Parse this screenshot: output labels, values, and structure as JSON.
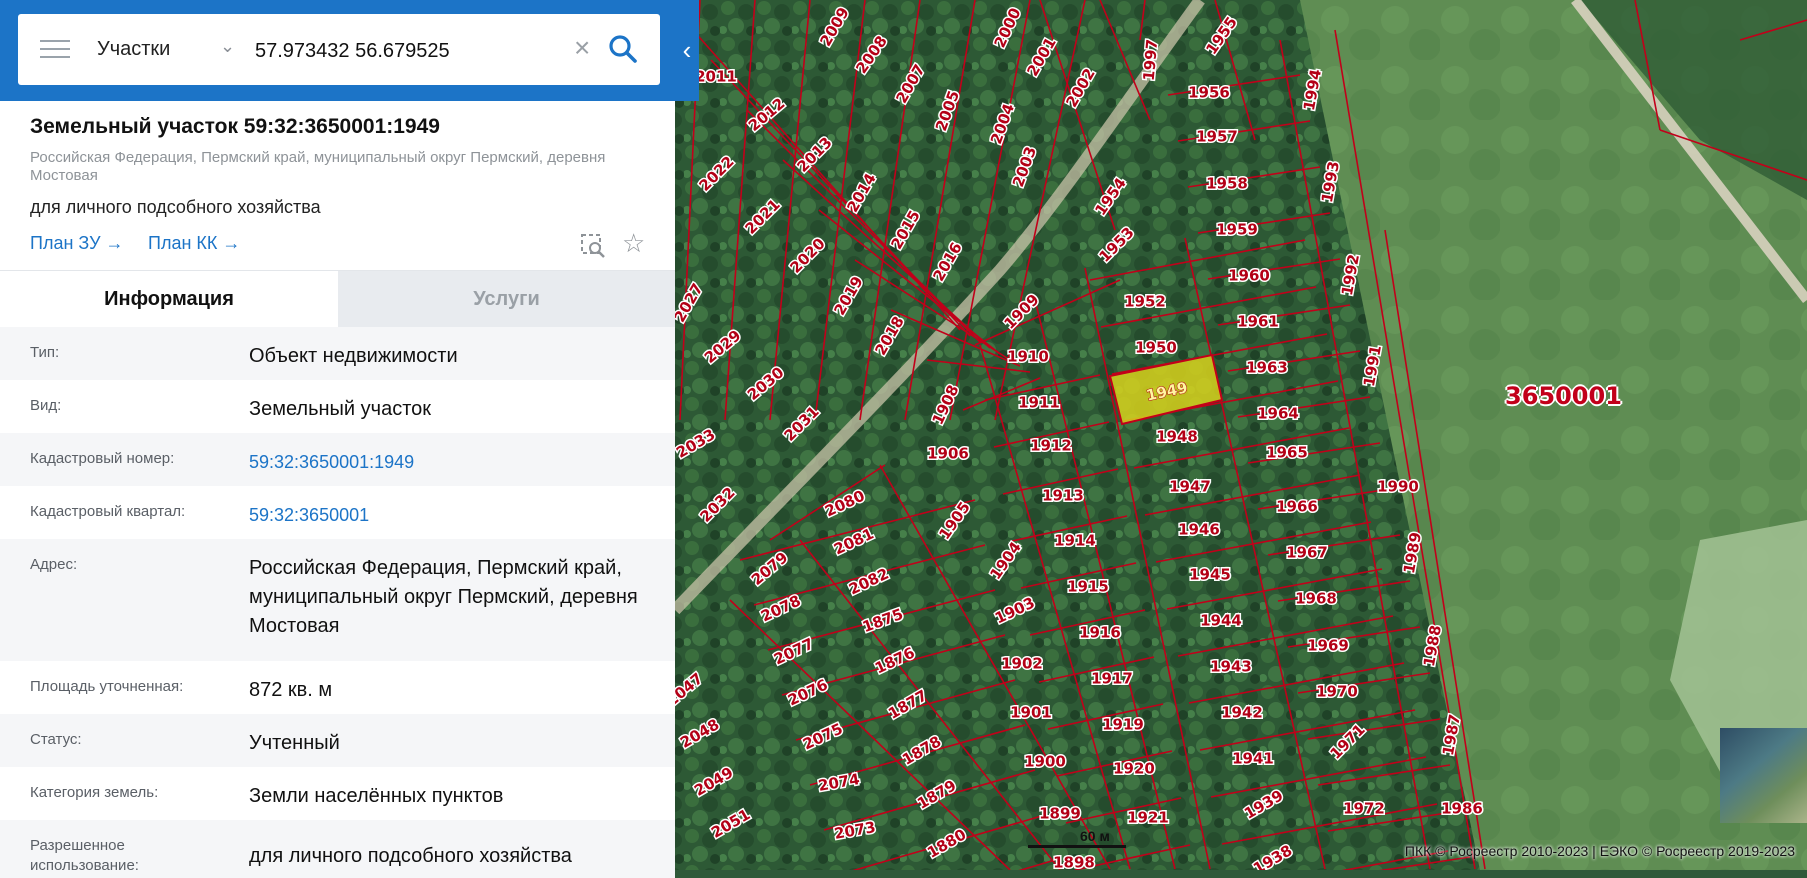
{
  "search": {
    "layer": "Участки",
    "query": "57.973432 56.679525"
  },
  "object": {
    "title": "Земельный участок 59:32:3650001:1949",
    "address_short": "Российская Федерация, Пермский край, муниципальный округ Пермский, деревня Мостовая",
    "use": "для личного подсобного хозяйства",
    "plan_zu": "План ЗУ →",
    "plan_kk": "План КК →"
  },
  "tabs": {
    "info": "Информация",
    "services": "Услуги"
  },
  "fields": [
    {
      "key": "Тип:",
      "value": "Объект недвижимости"
    },
    {
      "key": "Вид:",
      "value": "Земельный участок"
    },
    {
      "key": "Кадастровый номер:",
      "value": "59:32:3650001:1949"
    },
    {
      "key": "Кадастровый квартал:",
      "value": "59:32:3650001"
    },
    {
      "key": "Адрес:",
      "value": "Российская Федерация, Пермский край, муниципальный округ Пермский, деревня Мостовая"
    },
    {
      "key": "Площадь уточненная:",
      "value": "872 кв. м"
    },
    {
      "key": "Статус:",
      "value": "Учтенный"
    },
    {
      "key": "Категория земель:",
      "value": "Земли населённых пунктов"
    },
    {
      "key": "Разрешенное использование:",
      "value": "для личного подсобного хозяйства"
    }
  ],
  "map": {
    "quarter": "3650001",
    "scale": "60 м",
    "attribution": "ПКК © Росреестр 2010-2023 | ЕЭКО © Росреестр 2019-2023",
    "selected_plot": "1949",
    "plots": [
      "1949",
      "1950",
      "1952",
      "1953",
      "1954",
      "1955",
      "1956",
      "1957",
      "1958",
      "1959",
      "1960",
      "1961",
      "1963",
      "1964",
      "1965",
      "1966",
      "1967",
      "1968",
      "1969",
      "1970",
      "1971",
      "1972",
      "1986",
      "1987",
      "1988",
      "1989",
      "1990",
      "1991",
      "1992",
      "1993",
      "1994",
      "1997",
      "1948",
      "1947",
      "1946",
      "1945",
      "1944",
      "1943",
      "1942",
      "1941",
      "1939",
      "1938",
      "1909",
      "1910",
      "1911",
      "1912",
      "1913",
      "1914",
      "1915",
      "1916",
      "1917",
      "1919",
      "1920",
      "1921",
      "1902",
      "1901",
      "1900",
      "1899",
      "1898",
      "1903",
      "1904",
      "1905",
      "1906",
      "1908",
      "1880",
      "1879",
      "1878",
      "1877",
      "1876",
      "1875",
      "2080",
      "2081",
      "2082",
      "2079",
      "2078",
      "2077",
      "2076",
      "2075",
      "2074",
      "2073",
      "2051",
      "2049",
      "2048",
      "2047",
      "2033",
      "2032",
      "2031",
      "2030",
      "2029",
      "2027",
      "2022",
      "2021",
      "2020",
      "2019",
      "2018",
      "2016",
      "2015",
      "2014",
      "2013",
      "2012",
      "2011",
      "2009",
      "2008",
      "2007",
      "2005",
      "2004",
      "2003",
      "2002",
      "2001",
      "2000"
    ],
    "colors": {
      "boundary": "#c2001a",
      "selected_fill": "#d8d21c",
      "panel_accent": "#1c74c7"
    }
  }
}
